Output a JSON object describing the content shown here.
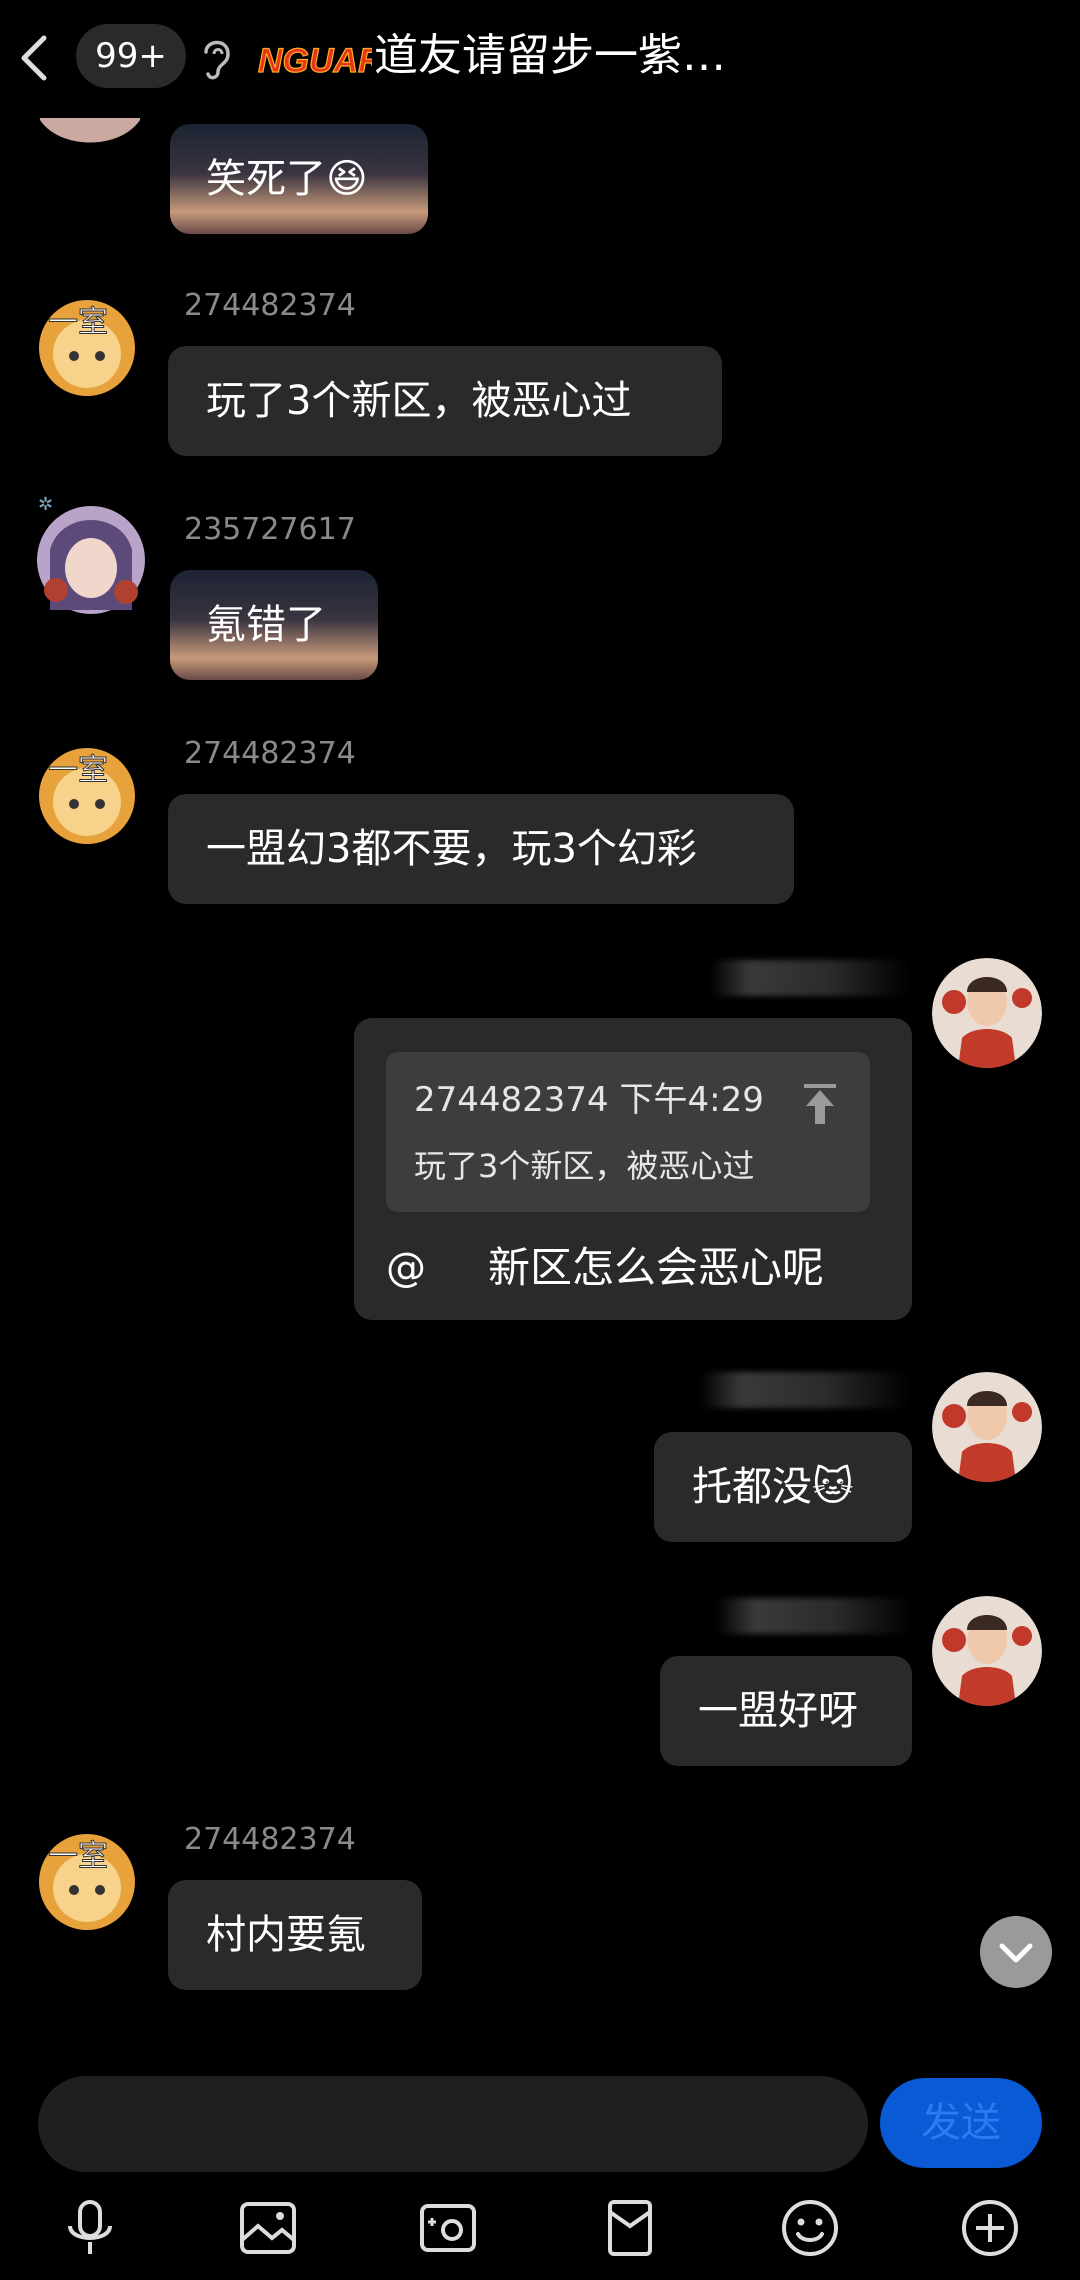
{
  "header": {
    "unread_count": "99+",
    "logo_text": "NGUARD",
    "title": "道友请留步一紫…"
  },
  "messages": [
    {
      "sender": "",
      "text": "笑死了",
      "emoji": "😆",
      "kind": "image-bubble"
    },
    {
      "sender": "274482374",
      "text": "玩了3个新区，被恶心过"
    },
    {
      "sender": "235727617",
      "text": "氪错了",
      "kind": "image-bubble"
    },
    {
      "sender": "274482374",
      "text": "一盟幻3都不要，玩3个幻彩"
    },
    {
      "self": true,
      "quote": {
        "sender": "274482374",
        "time": "下午4:29",
        "text": "玩了3个新区，被恶心过"
      },
      "at": "@",
      "text": "新区怎么会恶心呢"
    },
    {
      "self": true,
      "text": "托都没",
      "emoji": "🐱"
    },
    {
      "self": true,
      "text": "一盟好呀"
    },
    {
      "sender": "274482374",
      "text": "村内要氪"
    }
  ],
  "composer": {
    "input_value": "",
    "send_label": "发送"
  },
  "toolbar": [
    "microphone-icon",
    "image-icon",
    "camera-icon",
    "red-packet-icon",
    "emoji-icon",
    "plus-icon"
  ],
  "colors": {
    "background": "#000000",
    "bubble": "#2a2a2a",
    "send_button": "#0a5ad6"
  }
}
